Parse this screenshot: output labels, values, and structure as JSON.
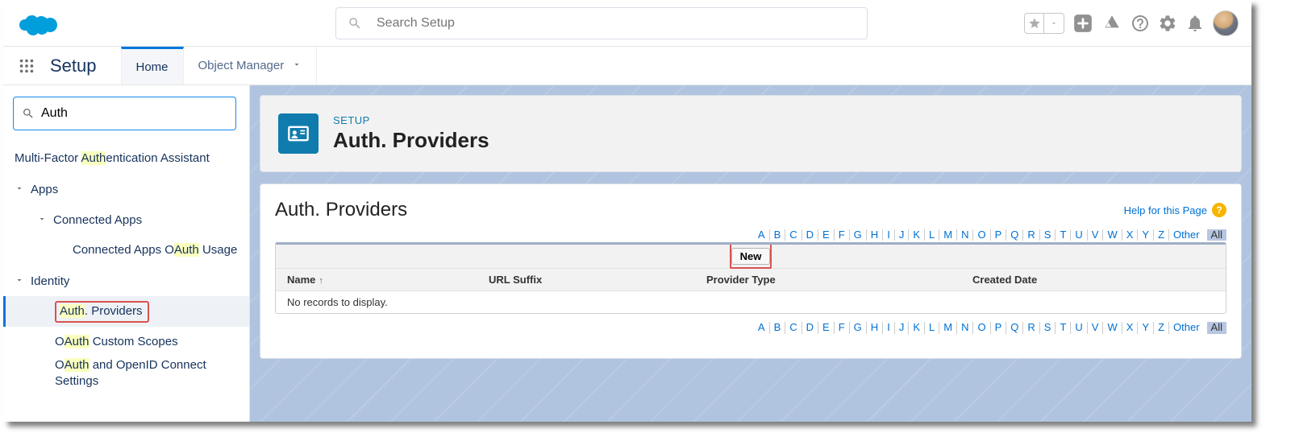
{
  "global_search": {
    "placeholder": "Search Setup"
  },
  "nav": {
    "app_name": "Setup",
    "home": "Home",
    "obj_mgr": "Object Manager"
  },
  "sidebar": {
    "search_value": "Auth",
    "mfa_pre": "Multi-Factor ",
    "mfa_hl": "Auth",
    "mfa_post": "entication Assistant",
    "apps": "Apps",
    "connected_apps": "Connected Apps",
    "connected_apps_oauth_pre": "Connected Apps O",
    "connected_apps_oauth_hl": "Auth",
    "connected_apps_oauth_post": " Usage",
    "identity": "Identity",
    "authp_hl": "Auth",
    "authp_post": ". Providers",
    "ocs_pre": "O",
    "ocs_hl": "Auth",
    "ocs_post": " Custom Scopes",
    "oidc_pre": "O",
    "oidc_hl": "Auth",
    "oidc_post": " and OpenID Connect Settings"
  },
  "header": {
    "eyebrow": "SETUP",
    "title": "Auth. Providers"
  },
  "list": {
    "title": "Auth. Providers",
    "help_text": "Help for this Page",
    "new_label": "New",
    "no_records": "No records to display.",
    "cols": {
      "name": "Name",
      "url_suffix": "URL Suffix",
      "provider_type": "Provider Type",
      "created_date": "Created Date"
    }
  },
  "alpha": {
    "letters": [
      "A",
      "B",
      "C",
      "D",
      "E",
      "F",
      "G",
      "H",
      "I",
      "J",
      "K",
      "L",
      "M",
      "N",
      "O",
      "P",
      "Q",
      "R",
      "S",
      "T",
      "U",
      "V",
      "W",
      "X",
      "Y",
      "Z"
    ],
    "other": "Other",
    "all": "All"
  }
}
